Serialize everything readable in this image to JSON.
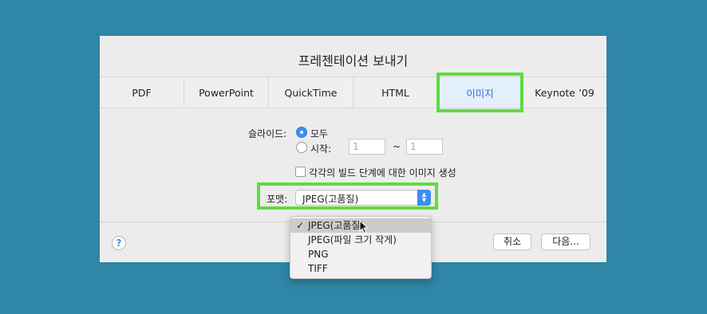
{
  "dialog": {
    "title": "프레젠테이션 보내기",
    "tabs": [
      {
        "label": "PDF"
      },
      {
        "label": "PowerPoint"
      },
      {
        "label": "QuickTime"
      },
      {
        "label": "HTML"
      },
      {
        "label": "이미지",
        "active": true
      },
      {
        "label": "Keynote ’09"
      }
    ],
    "slides": {
      "label": "슬라이드:",
      "all_label": "모두",
      "from_label": "시작:",
      "from_value": "1",
      "range_separator": "~",
      "to_value": "1"
    },
    "build_stages_label": "각각의 빌드 단계에 대한 이미지 생성",
    "format": {
      "label": "포맷:",
      "selected": "JPEG(고품질)",
      "options": [
        "JPEG(고품질)",
        "JPEG(파일 크기 작게)",
        "PNG",
        "TIFF"
      ]
    },
    "help_label": "?",
    "cancel_label": "취소",
    "next_label": "다음...",
    "highlight_color": "#5ddc3f",
    "accent_color": "#3b8df2"
  }
}
